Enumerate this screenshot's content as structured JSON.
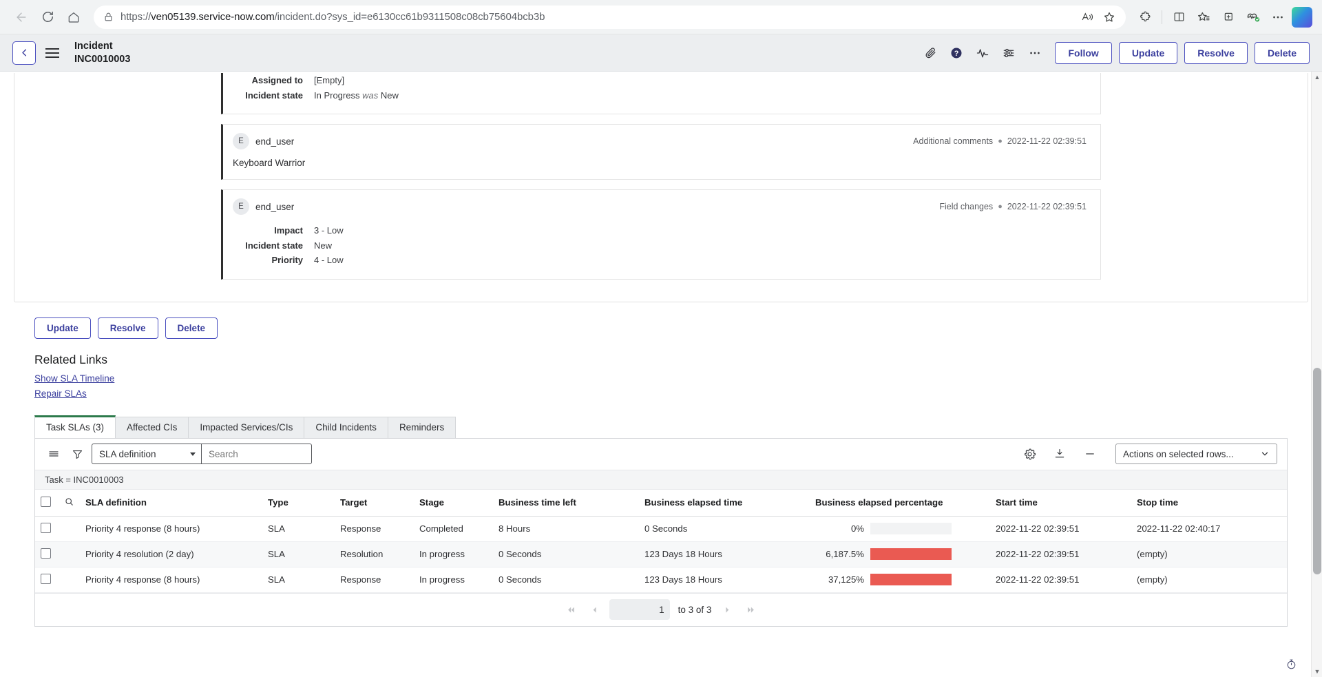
{
  "browser": {
    "url_prefix": "https://",
    "url_domain": "ven05139.service-now.com",
    "url_path": "/incident.do?sys_id=e6130cc61b9311508c08cb75604bcb3b",
    "url_full": "https://ven05139.service-now.com/incident.do?sys_id=e6130cc61b9311508c08cb75604bcb3b",
    "icons": {
      "back": "back-arrow-icon",
      "reload": "reload-icon",
      "home": "home-icon",
      "lock": "lock-icon",
      "read_aloud": "read-aloud-icon",
      "favorite": "star-icon",
      "extensions": "extensions-puzzle-icon",
      "split_screen": "split-screen-icon",
      "favorites_bar": "favorites-star-list-icon",
      "collections": "collections-icon",
      "browser_essentials": "browser-essentials-heartbeat-icon",
      "settings_more": "more-horizontal-icon",
      "copilot": "copilot-icon"
    }
  },
  "header": {
    "record_type": "Incident",
    "record_number": "INC0010003",
    "icons": {
      "back": "chevron-left-icon",
      "menu": "hamburger-menu-icon",
      "attachments": "paperclip-icon",
      "help": "help-circle-icon",
      "activity": "activity-pulse-icon",
      "personalize": "sliders-icon",
      "more": "more-horizontal-icon"
    },
    "buttons": [
      {
        "label": "Follow",
        "name": "follow-button"
      },
      {
        "label": "Update",
        "name": "update-button"
      },
      {
        "label": "Resolve",
        "name": "resolve-button"
      },
      {
        "label": "Delete",
        "name": "delete-button"
      }
    ]
  },
  "activity": {
    "entries": [
      {
        "type": "field-changes-partial",
        "fields": [
          {
            "label": "Assigned to",
            "value": "[Empty]",
            "was": ""
          },
          {
            "label": "Incident state",
            "value": "In Progress",
            "was_label": "was",
            "was": "New"
          }
        ]
      },
      {
        "avatar": "E",
        "user": "end_user",
        "kind": "Additional comments",
        "timestamp": "2022-11-22 02:39:51",
        "body": "Keyboard Warrior"
      },
      {
        "avatar": "E",
        "user": "end_user",
        "kind": "Field changes",
        "timestamp": "2022-11-22 02:39:51",
        "fields": [
          {
            "label": "Impact",
            "value": "3 - Low"
          },
          {
            "label": "Incident state",
            "value": "New"
          },
          {
            "label": "Priority",
            "value": "4 - Low"
          }
        ]
      }
    ]
  },
  "form_actions": [
    {
      "label": "Update",
      "name": "form-update-button"
    },
    {
      "label": "Resolve",
      "name": "form-resolve-button"
    },
    {
      "label": "Delete",
      "name": "form-delete-button"
    }
  ],
  "related_links": {
    "title": "Related Links",
    "links": [
      {
        "label": "Show SLA Timeline",
        "name": "show-sla-timeline-link"
      },
      {
        "label": "Repair SLAs",
        "name": "repair-slas-link"
      }
    ]
  },
  "tabs": [
    {
      "label": "Task SLAs (3)",
      "name": "tab-task-slas",
      "active": true
    },
    {
      "label": "Affected CIs",
      "name": "tab-affected-cis",
      "active": false
    },
    {
      "label": "Impacted Services/CIs",
      "name": "tab-impacted-services",
      "active": false
    },
    {
      "label": "Child Incidents",
      "name": "tab-child-incidents",
      "active": false
    },
    {
      "label": "Reminders",
      "name": "tab-reminders",
      "active": false
    }
  ],
  "list_toolbar": {
    "icons": {
      "list_menu": "list-menu-icon",
      "filter": "filter-funnel-icon",
      "settings": "gear-icon",
      "export": "download-export-icon",
      "collapse": "minus-icon"
    },
    "field_select": "SLA definition",
    "search_placeholder": "Search",
    "search_value": "",
    "actions_select": "Actions on selected rows..."
  },
  "list_breadcrumb": "Task = INC0010003",
  "table": {
    "columns": [
      "SLA definition",
      "Type",
      "Target",
      "Stage",
      "Business time left",
      "Business elapsed time",
      "Business elapsed percentage",
      "Start time",
      "Stop time"
    ],
    "rows": [
      {
        "sla_definition": "Priority 4 response (8 hours)",
        "type": "SLA",
        "target": "Response",
        "stage": "Completed",
        "business_time_left": "8 Hours",
        "business_elapsed_time": "0 Seconds",
        "business_elapsed_percentage": "0%",
        "percentage_value": 0,
        "bar_color": "#ea5a52",
        "start_time": "2022-11-22 02:39:51",
        "stop_time": "2022-11-22 02:40:17"
      },
      {
        "sla_definition": "Priority 4 resolution (2 day)",
        "type": "SLA",
        "target": "Resolution",
        "stage": "In progress",
        "business_time_left": "0 Seconds",
        "business_elapsed_time": "123 Days 18 Hours",
        "business_elapsed_percentage": "6,187.5%",
        "percentage_value": 100,
        "bar_color": "#ea5a52",
        "start_time": "2022-11-22 02:39:51",
        "stop_time": "(empty)"
      },
      {
        "sla_definition": "Priority 4 response (8 hours)",
        "type": "SLA",
        "target": "Response",
        "stage": "In progress",
        "business_time_left": "0 Seconds",
        "business_elapsed_time": "123 Days 18 Hours",
        "business_elapsed_percentage": "37,125%",
        "percentage_value": 100,
        "bar_color": "#ea5a52",
        "start_time": "2022-11-22 02:39:51",
        "stop_time": "(empty)"
      }
    ]
  },
  "pagination": {
    "page_value": "1",
    "range_text": "to 3 of 3",
    "first_icon": "double-chevron-left-icon",
    "prev_icon": "chevron-left-icon",
    "next_icon": "chevron-right-icon",
    "last_icon": "double-chevron-right-icon"
  },
  "footer": {
    "timer_icon": "stopwatch-icon"
  },
  "colors": {
    "accent_purple": "#3b3f9e",
    "tab_active_green": "#2c7a4b",
    "bar_red": "#ea5a52",
    "chrome_bg": "#f1f3f4",
    "sn_header_bg": "#eceef0"
  }
}
